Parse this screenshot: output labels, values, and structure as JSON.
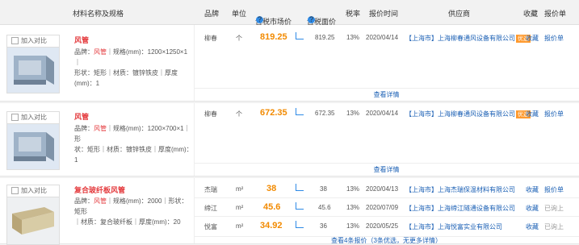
{
  "header": {
    "material": "材料名称及规格",
    "brand": "品牌",
    "unit": "单位",
    "tax_price": "含税市场价",
    "notax_price": "含税面价",
    "tax_rate": "税率",
    "quote_time": "报价时间",
    "supplier": "供应商",
    "favorite": "收藏",
    "quote": "报价单",
    "help": "?"
  },
  "products": [
    {
      "compare": "加入对比",
      "name": "风管",
      "desc_brand_label": "品牌：",
      "desc_brand": "风管",
      "desc_rest1": "｜规格(mm)：1200×1250×1｜",
      "desc_rest2": "形状：矩形｜材质：镀锌铁皮｜厚度(mm)：1",
      "detail": "查看详情",
      "rows": [
        {
          "brand": "柳春",
          "unit": "个",
          "price": "819.25",
          "notax": "819.25",
          "rate": "13%",
          "date": "2020/04/14",
          "supplier": "【上海市】上海柳春通风设备有限公司",
          "badge": "优选",
          "fav": "收藏",
          "quote": "报价单",
          "quote_active": true
        }
      ]
    },
    {
      "compare": "加入对比",
      "name": "风管",
      "desc_brand_label": "品牌：",
      "desc_brand": "风管",
      "desc_rest1": "｜规格(mm)：1200×700×1｜形",
      "desc_rest2": "状：矩形｜材质：镀锌铁皮｜厚度(mm)：1",
      "detail": "查看详情",
      "rows": [
        {
          "brand": "柳春",
          "unit": "个",
          "price": "672.35",
          "notax": "672.35",
          "rate": "13%",
          "date": "2020/04/14",
          "supplier": "【上海市】上海柳春通风设备有限公司",
          "badge": "优选",
          "fav": "收藏",
          "quote": "报价单",
          "quote_active": true
        }
      ]
    },
    {
      "compare": "加入对比",
      "name": "复合玻纤板风管",
      "desc_brand_label": "品牌：",
      "desc_brand": "风管",
      "desc_rest1": "｜规格(mm)：2000｜形状：矩形",
      "desc_rest2": "｜材质：复合玻纤板｜厚度(mm)：20",
      "detail": "查看4条报价（3条优选，无更多详情）",
      "rows": [
        {
          "brand": "杰瑞",
          "unit": "m²",
          "price": "38",
          "notax": "38",
          "rate": "13%",
          "date": "2020/04/13",
          "supplier": "【上海市】上海杰瑞保温材料有限公司",
          "badge": "",
          "fav": "收藏",
          "quote": "报价单",
          "quote_active": true
        },
        {
          "brand": "缔江",
          "unit": "m²",
          "price": "45.6",
          "notax": "45.6",
          "rate": "13%",
          "date": "2020/07/09",
          "supplier": "【上海市】上海缔江隧通设备有限公司",
          "badge": "",
          "fav": "收藏",
          "quote": "已询上",
          "quote_active": false
        },
        {
          "brand": "悦富",
          "unit": "m²",
          "price": "34.92",
          "notax": "36",
          "rate": "13%",
          "date": "2020/05/25",
          "supplier": "【上海市】上海悦富实业有限公司",
          "badge": "",
          "fav": "收藏",
          "quote": "已询上",
          "quote_active": false
        }
      ]
    }
  ]
}
